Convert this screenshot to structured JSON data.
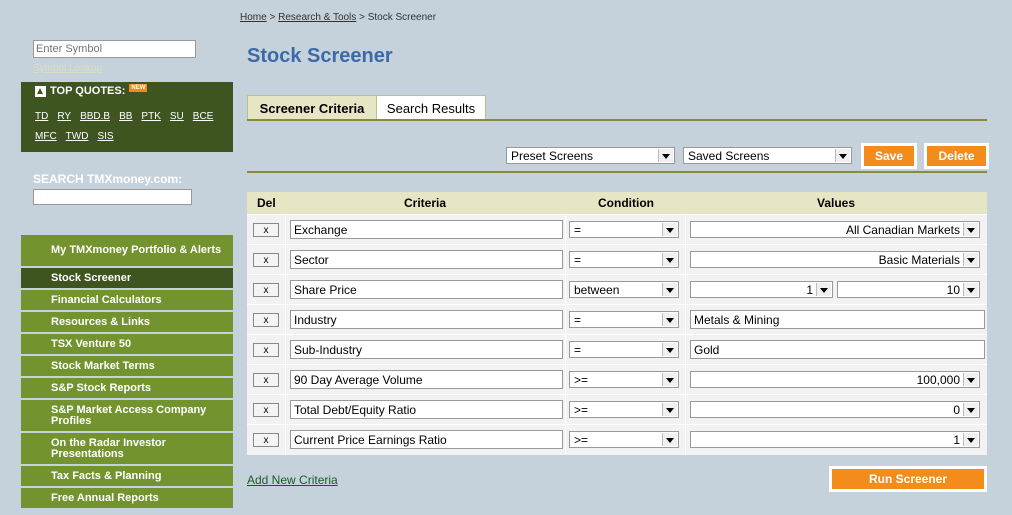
{
  "sidebar": {
    "symbol_placeholder": "Enter Symbol",
    "symbol_lookup": "Symbol Lookup",
    "top_quotes_title": "TOP QUOTES:",
    "new_badge": "NEW",
    "quotes": [
      "TD",
      "RY",
      "BBD.B",
      "BB",
      "PTK",
      "SU",
      "BCE",
      "MFC",
      "TWD",
      "SIS"
    ],
    "search_label": "SEARCH TMXmoney.com:",
    "nav": [
      {
        "label": "My TMXmoney Portfolio & Alerts",
        "active": false
      },
      {
        "label": "Stock Screener",
        "active": true
      },
      {
        "label": "Financial Calculators",
        "active": false
      },
      {
        "label": "Resources & Links",
        "active": false
      },
      {
        "label": "TSX Venture 50",
        "active": false
      },
      {
        "label": "Stock Market Terms",
        "active": false
      },
      {
        "label": "S&P Stock Reports",
        "active": false
      },
      {
        "label": "S&P Market Access Company Profiles",
        "active": false
      },
      {
        "label": "On the Radar Investor Presentations",
        "active": false
      },
      {
        "label": "Tax Facts & Planning",
        "active": false
      },
      {
        "label": "Free Annual Reports",
        "active": false
      }
    ]
  },
  "breadcrumb": {
    "home": "Home",
    "research": "Research & Tools",
    "current": "Stock Screener",
    "sep": ">"
  },
  "page_title": "Stock Screener",
  "tabs": {
    "criteria": "Screener Criteria",
    "results": "Search Results"
  },
  "toolbar": {
    "preset": "Preset Screens",
    "saved": "Saved Screens",
    "save": "Save",
    "delete": "Delete"
  },
  "table": {
    "headers": {
      "del": "Del",
      "criteria": "Criteria",
      "condition": "Condition",
      "values": "Values"
    },
    "delete_label": "x",
    "rows": [
      {
        "criteria": "Exchange",
        "condition": "=",
        "value": "All Canadian Markets"
      },
      {
        "criteria": "Sector",
        "condition": "=",
        "value": "Basic Materials"
      },
      {
        "criteria": "Share Price",
        "condition": "between",
        "value_from": "1",
        "value_to": "10"
      },
      {
        "criteria": "Industry",
        "condition": "=",
        "value": "Metals & Mining"
      },
      {
        "criteria": "Sub-Industry",
        "condition": "=",
        "value": "Gold"
      },
      {
        "criteria": "90 Day Average Volume",
        "condition": ">=",
        "value": "100,000"
      },
      {
        "criteria": "Total Debt/Equity Ratio",
        "condition": ">=",
        "value": "0"
      },
      {
        "criteria": "Current Price Earnings Ratio",
        "condition": ">=",
        "value": "1"
      }
    ]
  },
  "add_criteria": "Add New Criteria",
  "run": "Run Screener",
  "colors": {
    "accent_orange": "#f38c1a",
    "nav_green": "#73932f",
    "nav_dark": "#3e5520",
    "title_blue": "#3a6aa8",
    "page_bg": "#c5d2dc"
  }
}
